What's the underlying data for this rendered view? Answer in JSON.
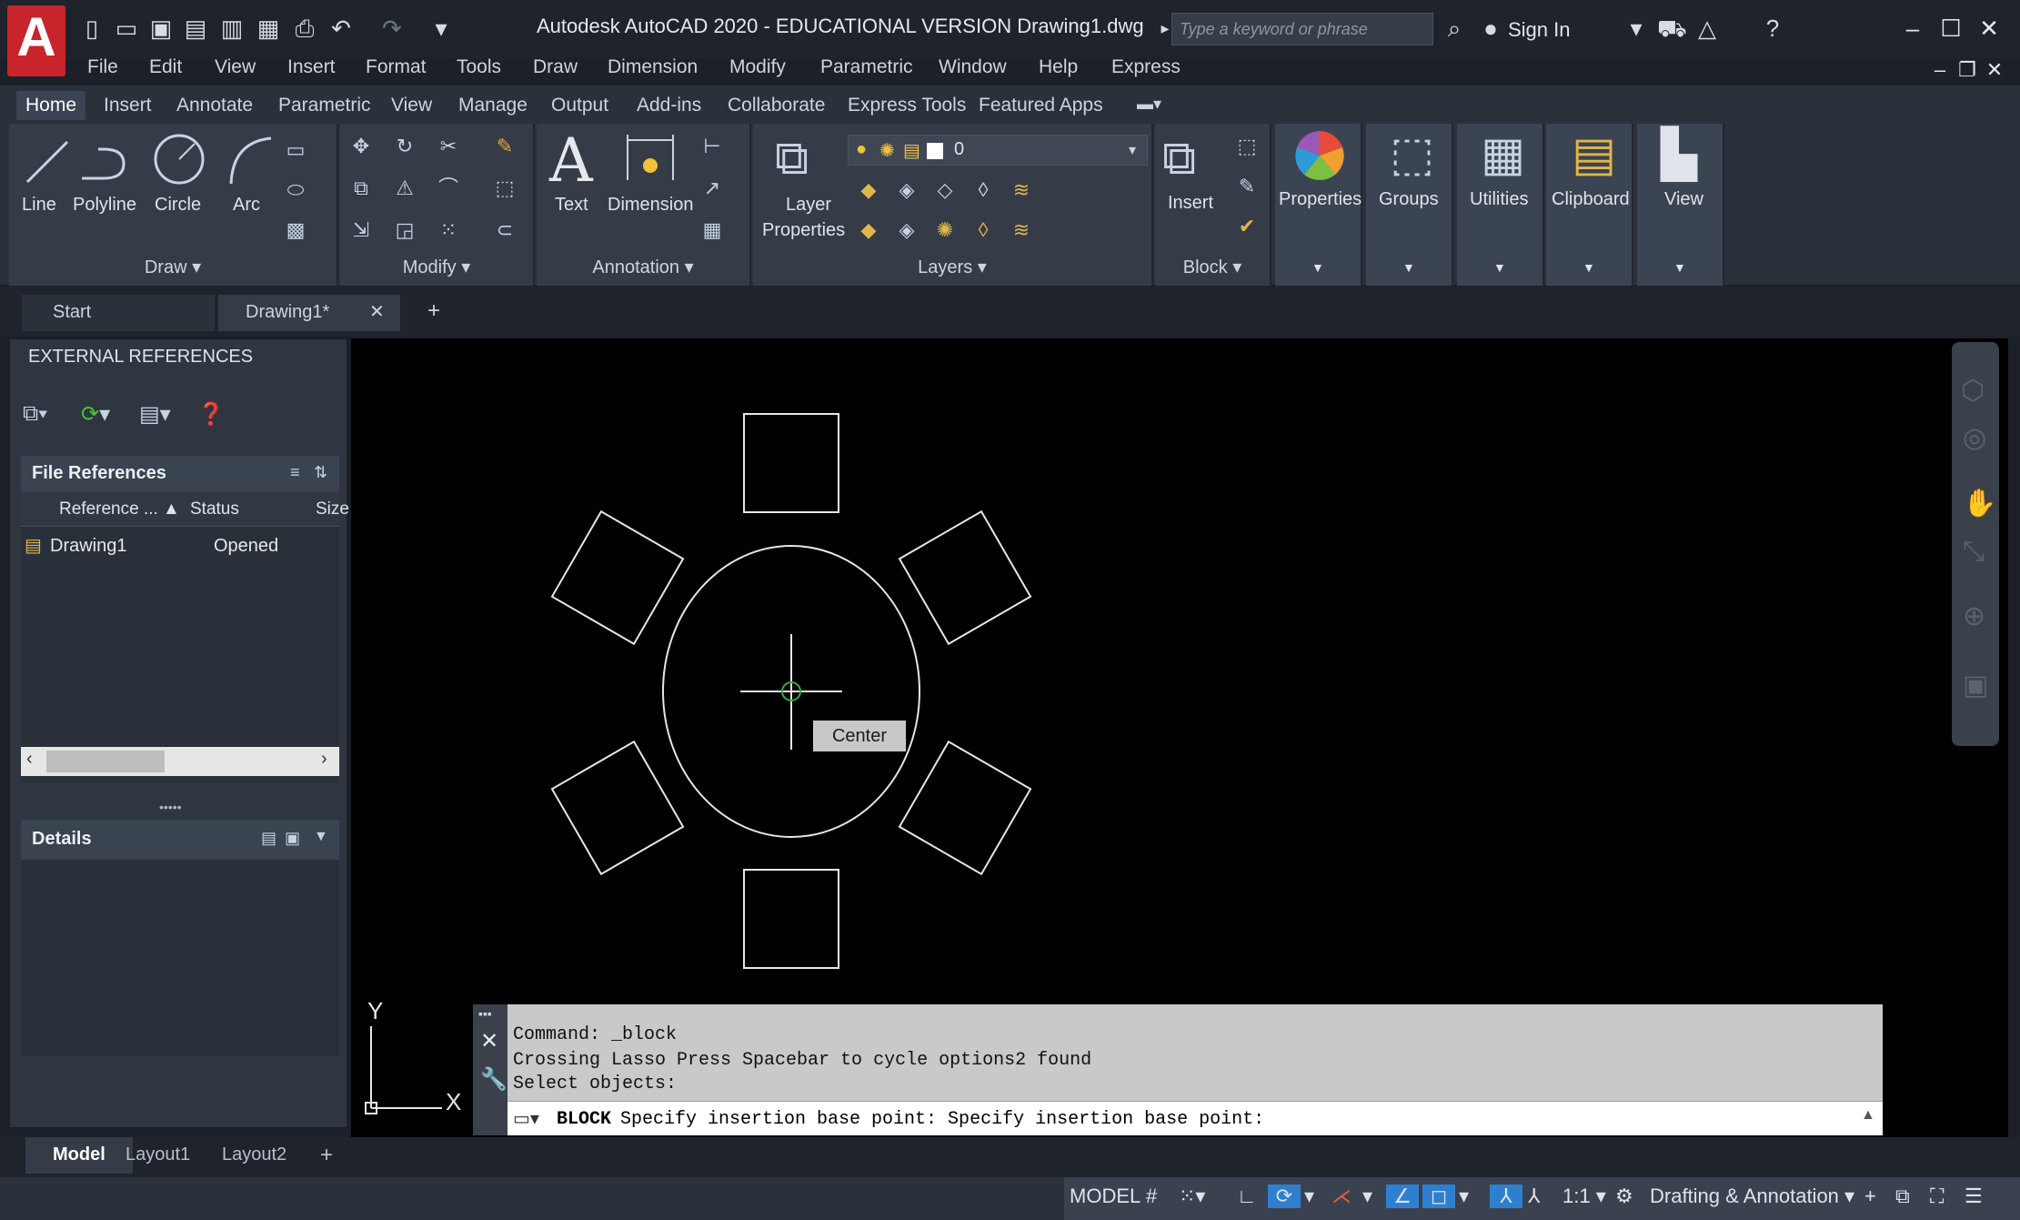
{
  "title_bar": {
    "title": "Autodesk AutoCAD 2020 - EDUCATIONAL VERSION    Drawing1.dwg",
    "search_placeholder": "Type a keyword or phrase",
    "sign_in": "Sign In",
    "logo": "A"
  },
  "menu": [
    "File",
    "Edit",
    "View",
    "Insert",
    "Format",
    "Tools",
    "Draw",
    "Dimension",
    "Modify",
    "Parametric",
    "Window",
    "Help",
    "Express"
  ],
  "ribbon_tabs": [
    "Home",
    "Insert",
    "Annotate",
    "Parametric",
    "View",
    "Manage",
    "Output",
    "Add-ins",
    "Collaborate",
    "Express Tools",
    "Featured Apps"
  ],
  "ribbon": {
    "draw": {
      "title": "Draw",
      "line": "Line",
      "polyline": "Polyline",
      "circle": "Circle",
      "arc": "Arc"
    },
    "modify": {
      "title": "Modify"
    },
    "annotation": {
      "title": "Annotation",
      "text": "Text",
      "dimension": "Dimension"
    },
    "layers": {
      "title": "Layers",
      "layer_props_1": "Layer",
      "layer_props_2": "Properties",
      "current_layer": "0"
    },
    "block": {
      "title": "Block",
      "insert": "Insert"
    },
    "properties": "Properties",
    "groups": "Groups",
    "utilities": "Utilities",
    "clipboard": "Clipboard",
    "view": "View"
  },
  "file_tabs": {
    "start": "Start",
    "drawing": "Drawing1*"
  },
  "palette": {
    "title": "EXTERNAL REFERENCES",
    "file_references": "File References",
    "columns": [
      "Reference ...",
      "Status",
      "Size"
    ],
    "rows": [
      {
        "name": "Drawing1",
        "status": "Opened"
      }
    ],
    "details": "Details"
  },
  "canvas": {
    "tooltip": "Center",
    "ucs_y": "Y",
    "ucs_x": "X"
  },
  "command": {
    "lines": [
      "Command: _block",
      "Crossing Lasso  Press Spacebar to cycle options2 found",
      "Select objects:"
    ],
    "prompt_keyword": "BLOCK",
    "prompt_text": "Specify insertion base point: Specify insertion base point:"
  },
  "layout_tabs": [
    "Model",
    "Layout1",
    "Layout2"
  ],
  "status": {
    "model": "MODEL",
    "scale": "1:1",
    "workspace": "Drafting & Annotation"
  }
}
